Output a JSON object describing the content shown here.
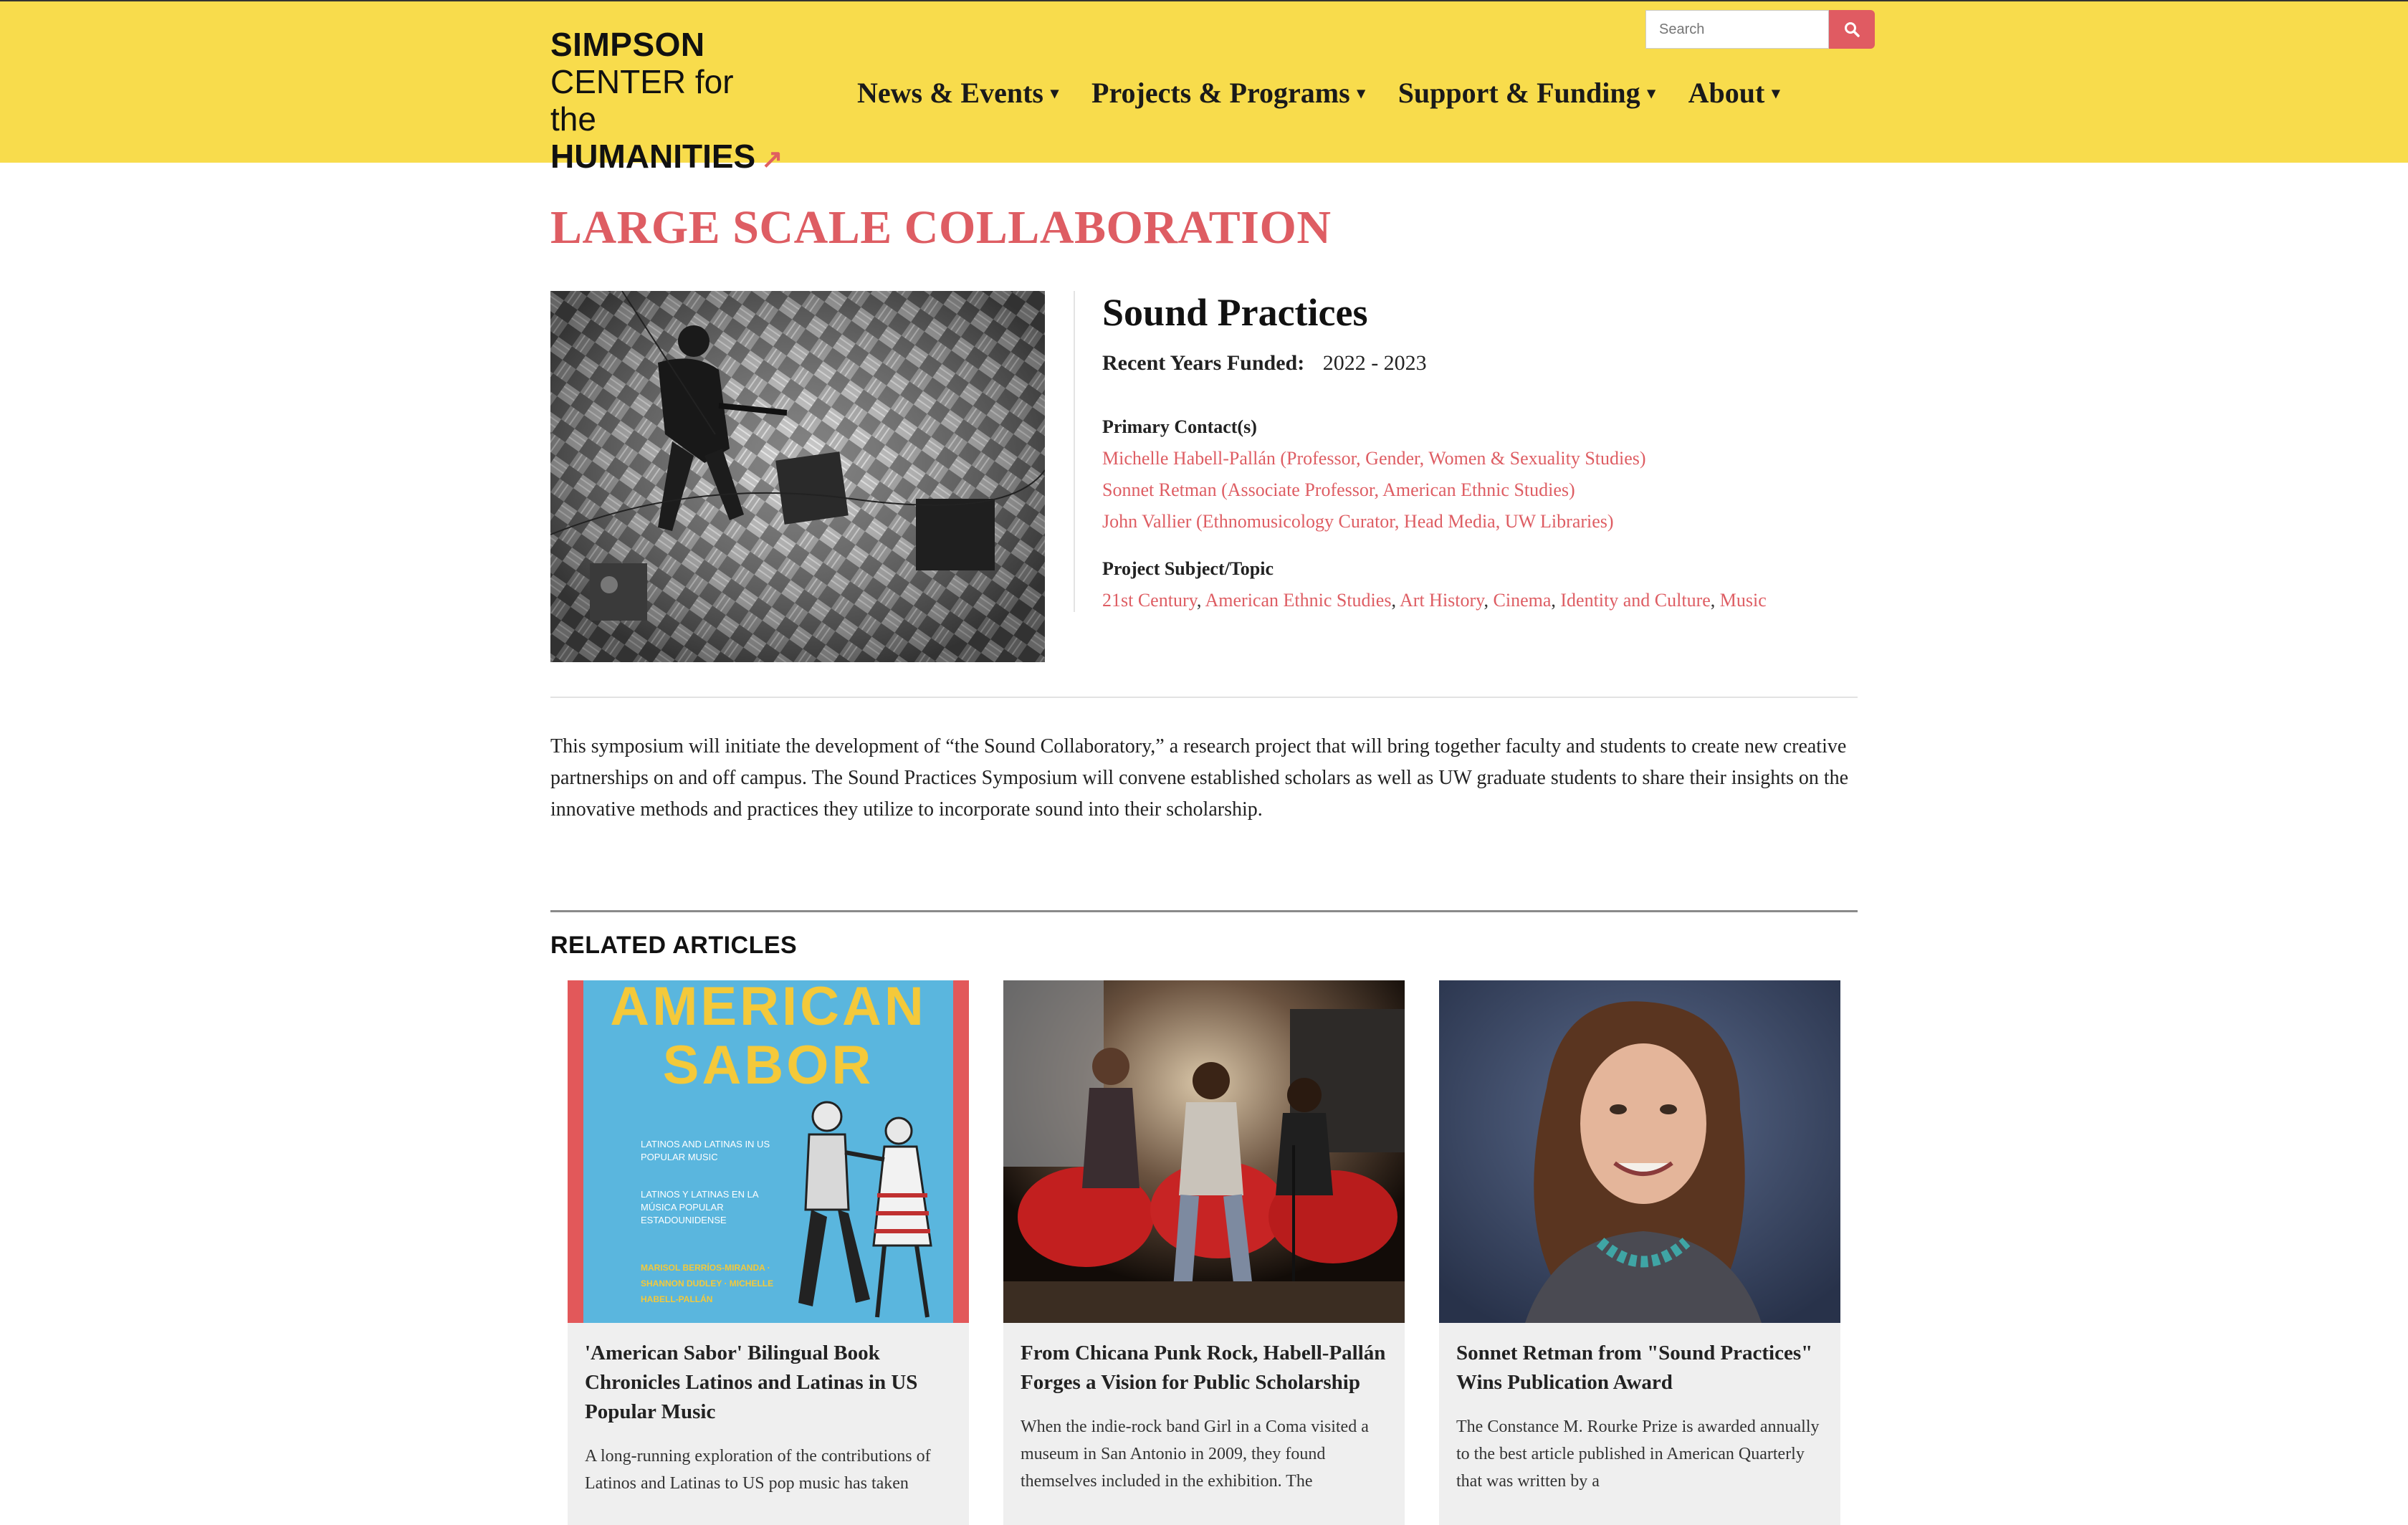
{
  "site": {
    "logo_line1": "SIMPSON",
    "logo_line2": "CENTER for the",
    "logo_line3": "HUMANITIES",
    "accent_color": "#de5d63",
    "header_color": "#f8dc4c"
  },
  "nav": [
    {
      "label": "News & Events"
    },
    {
      "label": "Projects & Programs"
    },
    {
      "label": "Support & Funding"
    },
    {
      "label": "About"
    }
  ],
  "search": {
    "placeholder": "Search",
    "icon": "search-icon"
  },
  "page": {
    "title": "LARGE SCALE COLLABORATION",
    "project_title": "Sound Practices",
    "years_label": "Recent Years Funded:",
    "years_value": "2022 - 2023",
    "contacts_label": "Primary Contact(s)",
    "contacts": [
      "Michelle Habell-Pallán (Professor, Gender, Women & Sexuality Studies)",
      "Sonnet Retman (Associate Professor, American Ethnic Studies)",
      "John Vallier (Ethnomusicology Curator, Head Media, UW Libraries)"
    ],
    "topics_label": "Project Subject/Topic",
    "topics": [
      "21st Century",
      "American Ethnic Studies",
      "Art History",
      "Cinema",
      "Identity and Culture",
      "Music"
    ],
    "description": "This symposium will initiate the development of “the Sound Collaboratory,” a research project that will bring together faculty and students to create new creative partnerships on and off campus. The Sound Practices Symposium will convene established scholars as well as UW graduate students to share their insights on the innovative methods and practices they utilize to incorporate sound into their scholarship."
  },
  "related": {
    "title": "RELATED ARTICLES",
    "cards": [
      {
        "title": "'American Sabor' Bilingual Book Chronicles Latinos and Latinas in US Popular Music",
        "text": "A long-running exploration of the contributions of Latinos and Latinas to US pop music has taken",
        "cover_title": "AMERICAN SABOR",
        "cover_sub1": "LATINOS AND LATINAS IN US POPULAR MUSIC",
        "cover_sub2": "LATINOS Y LATINAS EN LA MÚSICA POPULAR ESTADOUNIDENSE",
        "cover_authors": "MARISOL BERRÍOS-MIRANDA · SHANNON DUDLEY · MICHELLE HABELL-PALLÁN"
      },
      {
        "title": "From Chicana Punk Rock, Habell-Pallán Forges a Vision for Public Scholarship",
        "text": "When the indie-rock band Girl in a Coma visited a museum in San Antonio in 2009, they found themselves included in the exhibition. The"
      },
      {
        "title": "Sonnet Retman from \"Sound Practices\" Wins Publication Award",
        "text": "The Constance M. Rourke Prize is awarded annually to the best article published in American Quarterly that was written by a"
      }
    ]
  }
}
